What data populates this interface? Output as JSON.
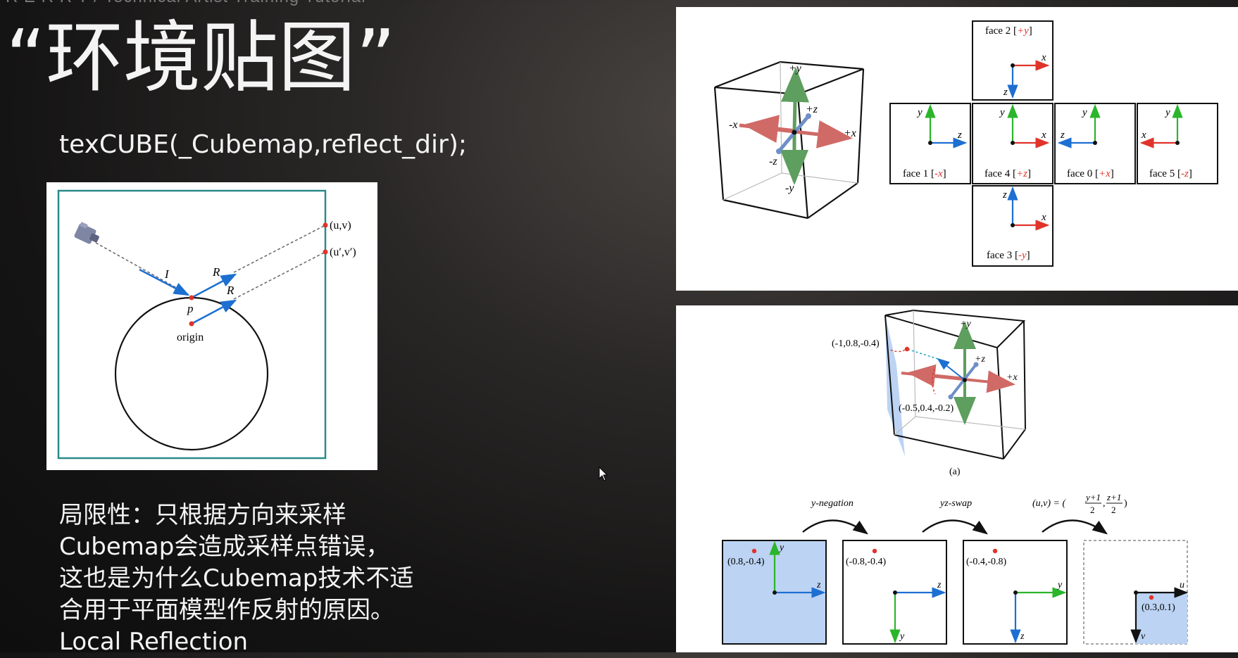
{
  "header": "R E R R T / Technical Artist Training Tutorial",
  "title": "“环境贴图”",
  "code_line": "texCUBE(_Cubemap,reflect_dir);",
  "body_lines": [
    "局限性：只根据方向来采样",
    "Cubemap会造成采样点错误，",
    "这也是为什么Cubemap技术不适",
    "合用于平面模型作反射的原因。",
    "Local Reflection"
  ],
  "reflection_diagram": {
    "uv_label": "(u,v)",
    "uv_prime_label": "(u′,v′)",
    "incident_label": "I",
    "reflect_label": "R",
    "point_label": "p",
    "origin_label": "origin"
  },
  "cube_diagram": {
    "axes": {
      "pos_y": "+y",
      "neg_y": "-y",
      "pos_x": "+x",
      "neg_x": "-x",
      "pos_z": "+z",
      "neg_z": "-z"
    },
    "faces": {
      "face2": {
        "prefix": "face 2 [",
        "sign": "+y",
        "suffix": "]",
        "h": "x",
        "v": "z"
      },
      "face1": {
        "prefix": "face 1 [",
        "sign": "-x",
        "suffix": "]",
        "h": "z",
        "v": "y"
      },
      "face4": {
        "prefix": "face 4 [",
        "sign": "+z",
        "suffix": "]",
        "h": "x",
        "v": "y"
      },
      "face0": {
        "prefix": "face 0 [",
        "sign": "+x",
        "suffix": "]",
        "h": "z",
        "v": "y"
      },
      "face5": {
        "prefix": "face 5 [",
        "sign": "-z",
        "suffix": "]",
        "h": "x",
        "v": "y"
      },
      "face3": {
        "prefix": "face 3 [",
        "sign": "-y",
        "suffix": "]",
        "h": "x",
        "v": "z"
      }
    }
  },
  "sampling_diagram": {
    "point_a": "(-1,0.8,-0.4)",
    "point_b": "(-0.5,0.4,-0.2)",
    "axes": {
      "pos_y": "+y",
      "pos_z": "+z",
      "pos_x": "+x"
    },
    "caption": "(a)",
    "steps": [
      "y-negation",
      "yz-swap"
    ],
    "formula": {
      "lhs": "(u,v) = (",
      "f1_num": "y+1",
      "f1_den": "2",
      "sep": ",",
      "f2_num": "z+1",
      "f2_den": "2",
      "rhs": ")"
    },
    "boxes": [
      {
        "coord": "(0.8,-0.4)",
        "h": "z",
        "v": "y"
      },
      {
        "coord": "(-0.8,-0.4)",
        "h": "z",
        "v": "y"
      },
      {
        "coord": "(-0.4,-0.8)",
        "h": "y",
        "v": "z"
      },
      {
        "coord": "(0.3,0.1)",
        "h": "u",
        "v": "v"
      }
    ]
  },
  "colors": {
    "teal_frame": "#2a8a88",
    "arrow_blue": "#1d6fd1",
    "arrow_red": "#e0332a",
    "arrow_green": "#2bb52b",
    "highlight_fill": "#bcd3f3"
  }
}
